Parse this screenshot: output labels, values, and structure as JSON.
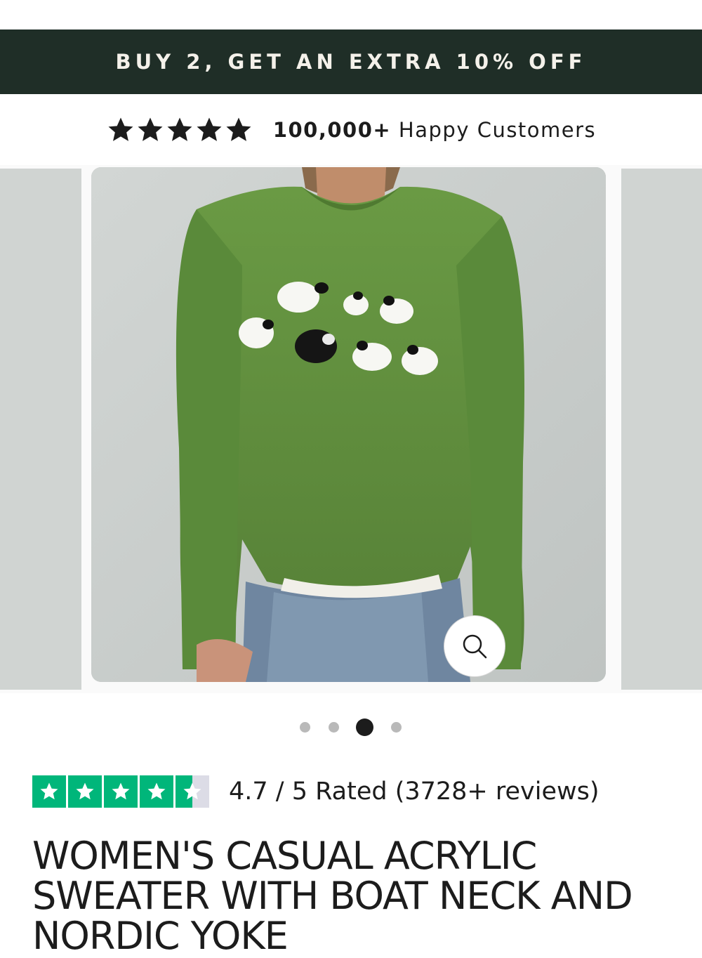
{
  "promo": {
    "text": "BUY 2, GET AN EXTRA 10% OFF"
  },
  "social_proof": {
    "stars": 5,
    "count": "100,000+",
    "label": "Happy Customers"
  },
  "gallery": {
    "slide_count": 4,
    "active_index": 2,
    "zoom_icon": "magnifier-icon"
  },
  "rating": {
    "score": 4.7,
    "stars_filled": 4.5,
    "text": "4.7 / 5 Rated (3728+ reviews)"
  },
  "product": {
    "title": "WOMEN'S CASUAL ACRYLIC SWEATER WITH BOAT NECK AND NORDIC YOKE"
  },
  "colors": {
    "promo_bg": "#1f2e27",
    "trustpilot_green": "#00b67a",
    "sweater_green": "#5f8f3c"
  }
}
